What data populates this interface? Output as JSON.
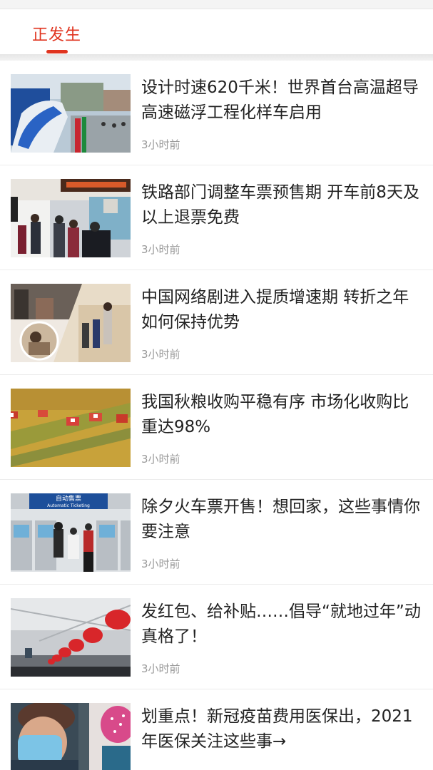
{
  "tabs": [
    {
      "label": "正发生"
    }
  ],
  "colors": {
    "accent": "#e0341f",
    "title_text": "#222222",
    "time_text": "#9a9a9a"
  },
  "articles": [
    {
      "title": "设计时速620千米！世界首台高温超导高速磁浮工程化样车启用",
      "time": "3小时前",
      "image": "maglev-train-photo"
    },
    {
      "title": "铁路部门调整车票预售期 开车前8天及以上退票免费",
      "time": "3小时前",
      "image": "railway-ticket-hall-photo"
    },
    {
      "title": "中国网络剧进入提质增速期 转折之年如何保持优势",
      "time": "3小时前",
      "image": "web-drama-collage-photo"
    },
    {
      "title": "我国秋粮收购平稳有序 市场化收购比重达98%",
      "time": "3小时前",
      "image": "harvest-field-photo"
    },
    {
      "title": "除夕火车票开售！想回家，这些事情你要注意",
      "time": "3小时前",
      "image": "ticket-machines-photo"
    },
    {
      "title": "发红包、给补贴……倡导“就地过年”动真格了！",
      "time": "3小时前",
      "image": "red-lanterns-station-photo"
    },
    {
      "title": "划重点！新冠疫苗费用医保出，2021年医保关注这些事→",
      "time": "",
      "image": "vaccination-photo"
    }
  ],
  "thumbnail_text": {
    "ticket_sign": "自动售票",
    "ticket_sign_en": "Automatic Ticketing"
  }
}
